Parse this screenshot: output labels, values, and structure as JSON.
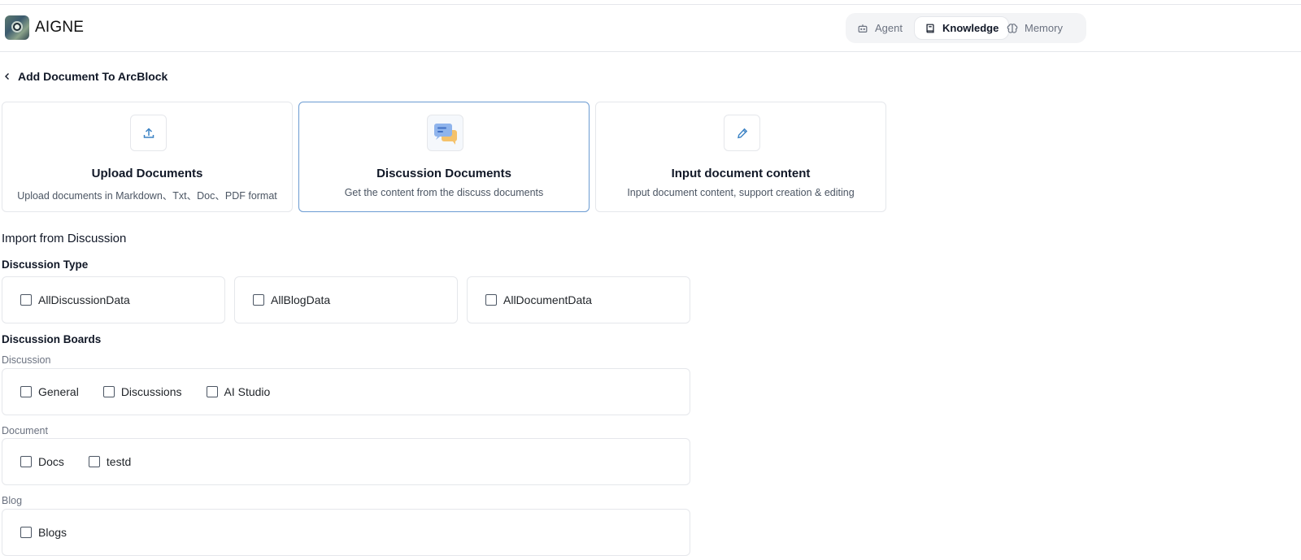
{
  "header": {
    "app_title": "AIGNE",
    "tabs": [
      {
        "label": "Agent",
        "icon": "bot-icon",
        "active": false
      },
      {
        "label": "Knowledge",
        "icon": "book-icon",
        "active": true
      },
      {
        "label": "Memory",
        "icon": "brain-icon",
        "active": false
      }
    ]
  },
  "page": {
    "back_label": "Add Document To ArcBlock"
  },
  "sources": [
    {
      "title": "Upload Documents",
      "desc": "Upload documents in Markdown、Txt、Doc、PDF format",
      "icon": "upload-icon",
      "selected": false
    },
    {
      "title": "Discussion Documents",
      "desc": "Get the content from the discuss documents",
      "icon": "chat-bubbles-icon",
      "selected": true
    },
    {
      "title": "Input document content",
      "desc": "Input document content, support creation & editing",
      "icon": "pencil-icon",
      "selected": false
    }
  ],
  "import": {
    "title": "Import from Discussion",
    "type_title": "Discussion Type",
    "types": [
      "AllDiscussionData",
      "AllBlogData",
      "AllDocumentData"
    ],
    "boards_title": "Discussion Boards",
    "groups": [
      {
        "label": "Discussion",
        "items": [
          "General",
          "Discussions",
          "AI Studio"
        ]
      },
      {
        "label": "Document",
        "items": [
          "Docs",
          "testd"
        ]
      },
      {
        "label": "Blog",
        "items": [
          "Blogs"
        ]
      }
    ]
  },
  "colors": {
    "selected_border": "#6b9bd2",
    "icon_blue": "#3b82c4",
    "border": "#e5e7eb"
  }
}
